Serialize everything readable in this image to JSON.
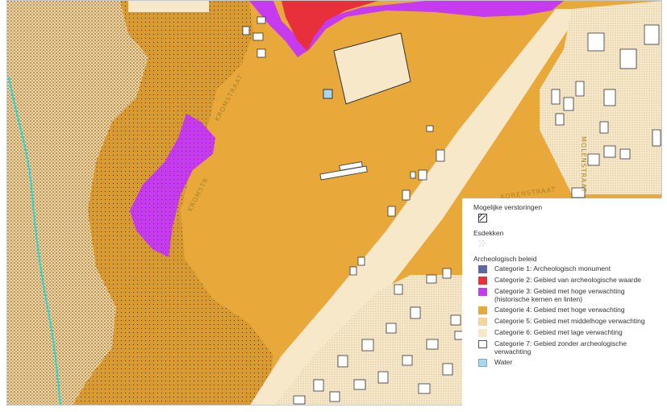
{
  "map": {
    "streets": [
      "KROMSTRAAT",
      "KROMSTR",
      "KORENSTRAAT",
      "MOLENSTRAAT"
    ],
    "colors": {
      "cat2": "#e8303a",
      "cat3": "#c63bf0",
      "cat4": "#e8a93a",
      "cat5": "#f3d49a",
      "cat6": "#f6e8c8",
      "water": "#2ad7d0",
      "cat7": "#ffffff"
    }
  },
  "legend": {
    "section_disturbances": "Mogelijke verstoringen",
    "section_esdekken": "Esdekken",
    "section_policy": "Archeologisch beleid",
    "items": [
      {
        "label": "Categorie 1: Archeologisch monument",
        "color": "#5b6aa3",
        "icon": "swatch-cat1"
      },
      {
        "label": "Categorie 2: Gebied van archeologische waarde",
        "color": "#e8303a",
        "icon": "swatch-cat2"
      },
      {
        "label": "Categorie 3: Gebied met hoge verwachting (historische kernen en linten)",
        "color": "#c63bf0",
        "icon": "swatch-cat3"
      },
      {
        "label": "Categorie 4: Gebied met hoge verwachting",
        "color": "#e8a93a",
        "icon": "swatch-cat4"
      },
      {
        "label": "Categorie 5: Gebied met middelhoge verwachting",
        "color": "#f3d49a",
        "icon": "swatch-cat5"
      },
      {
        "label": "Categorie 6: Gebied met lage verwachting",
        "color": "#f6e8c8",
        "icon": "swatch-cat6"
      },
      {
        "label": "Categorie 7: Gebied zonder archeologische verwachting",
        "color": "#ffffff",
        "icon": "swatch-cat7"
      },
      {
        "label": "Water",
        "color": "#a8d8f0",
        "icon": "swatch-water"
      }
    ]
  }
}
